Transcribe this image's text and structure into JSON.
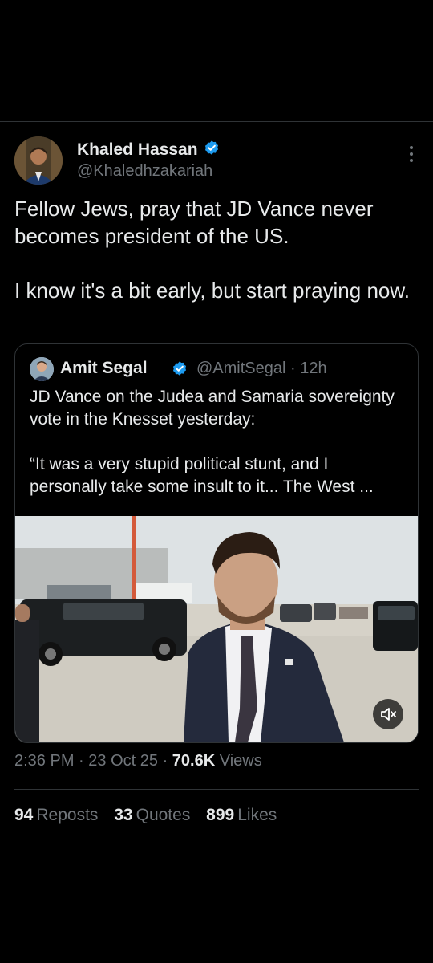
{
  "tweet": {
    "author": {
      "display_name": "Khaled Hassan",
      "handle": "@Khaledhzakariah",
      "verified": true
    },
    "text_paragraphs": [
      "Fellow Jews, pray that JD Vance never becomes president of the US.",
      "I know it's a bit early, but start praying now."
    ],
    "quoted": {
      "display_name": "Amit Segal",
      "handle": "@AmitSegal",
      "separator": "·",
      "time_ago": "12h",
      "verified": true,
      "text_paragraphs": [
        "JD Vance on the Judea and Samaria sovereignty vote in the Knesset yesterday:",
        "“It was a very stupid political stunt, and I personally take some insult to it... The West ..."
      ],
      "media": {
        "type": "video",
        "muted_icon": "volume-muted-icon"
      }
    },
    "time": "2:36 PM",
    "date": "23 Oct 25",
    "views_count": "70.6K",
    "views_label": "Views",
    "separator": "·",
    "stats": {
      "reposts_count": "94",
      "reposts_label": "Reposts",
      "quotes_count": "33",
      "quotes_label": "Quotes",
      "likes_count": "899",
      "likes_label": "Likes"
    }
  },
  "colors": {
    "background": "#000000",
    "text_primary": "#e7e9ea",
    "text_secondary": "#71767b",
    "divider": "#2f3336",
    "verified_blue": "#1d9bf0"
  }
}
